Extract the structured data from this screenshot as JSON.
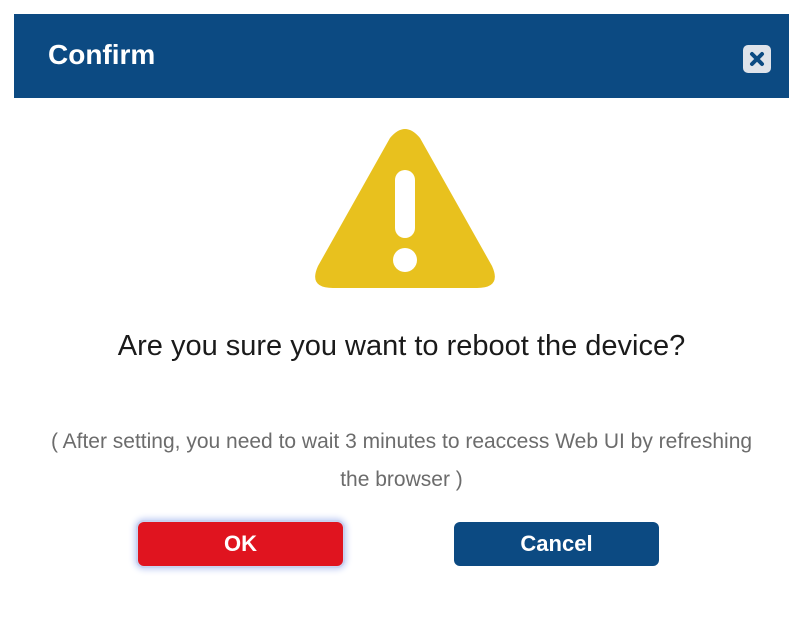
{
  "dialog": {
    "title": "Confirm",
    "close_icon": "close-icon",
    "warning_icon": "warning-triangle-icon",
    "message": "Are you sure you want to reboot the device?",
    "note": "( After setting, you need to wait 3 minutes to reaccess Web UI by refreshing the browser )",
    "ok_label": "OK",
    "cancel_label": "Cancel"
  },
  "colors": {
    "header": "#0c4a82",
    "ok_button": "#e0141f",
    "cancel_button": "#0c4a82",
    "warning": "#e8c11e"
  }
}
